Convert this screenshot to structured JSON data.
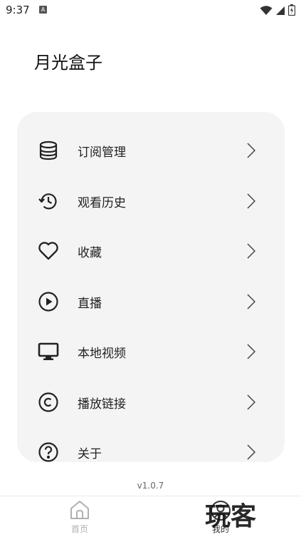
{
  "status_bar": {
    "time": "9:37",
    "notification_badge": "A",
    "icons": [
      "wifi-icon",
      "signal-icon",
      "battery-icon"
    ]
  },
  "app": {
    "title": "月光盒子"
  },
  "menu": {
    "items": [
      {
        "label": "订阅管理",
        "icon": "database-icon"
      },
      {
        "label": "观看历史",
        "icon": "history-icon"
      },
      {
        "label": "收藏",
        "icon": "heart-icon"
      },
      {
        "label": "直播",
        "icon": "play-circle-icon"
      },
      {
        "label": "本地视频",
        "icon": "monitor-icon"
      },
      {
        "label": "播放链接",
        "icon": "copyright-icon"
      },
      {
        "label": "关于",
        "icon": "help-icon"
      }
    ]
  },
  "footer": {
    "version": "v1.0.7"
  },
  "tab_bar": {
    "tabs": [
      {
        "label": "首页",
        "icon": "home-icon",
        "active": false
      },
      {
        "label": "我的",
        "icon": "profile-icon",
        "active": true
      }
    ]
  },
  "watermark": {
    "text": "玩客"
  },
  "colors": {
    "card_bg": "#f4f4f4",
    "icon": "#222222",
    "inactive_tab": "#b0b0b0",
    "active_tab": "#333333"
  }
}
